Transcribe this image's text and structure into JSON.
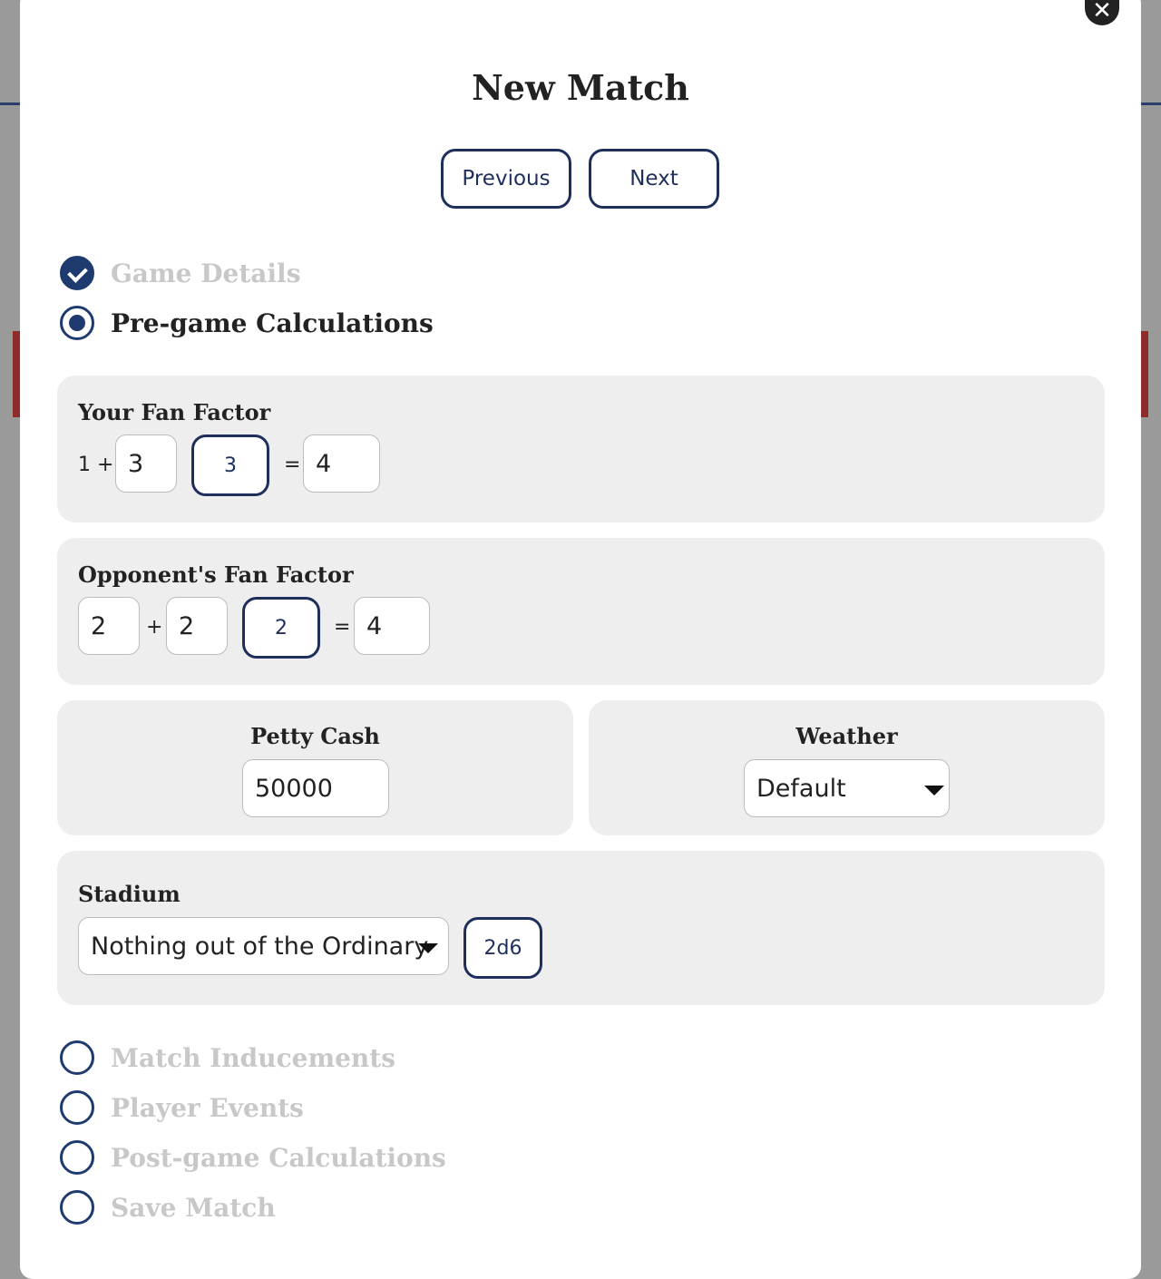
{
  "modal": {
    "title": "New Match",
    "close_icon": "close-icon",
    "previous_label": "Previous",
    "next_label": "Next"
  },
  "steps": [
    {
      "label": "Game Details",
      "state": "done"
    },
    {
      "label": "Pre-game Calculations",
      "state": "current"
    },
    {
      "label": "Match Inducements",
      "state": "pending"
    },
    {
      "label": "Player Events",
      "state": "pending"
    },
    {
      "label": "Post-game Calculations",
      "state": "pending"
    },
    {
      "label": "Save Match",
      "state": "pending"
    }
  ],
  "your_fan_factor": {
    "title": "Your Fan Factor",
    "base": "1 +",
    "input": "3",
    "roll": "3",
    "equals": "=",
    "result": "4"
  },
  "opponent_fan_factor": {
    "title": "Opponent's Fan Factor",
    "input_a": "2",
    "plus": "+",
    "input_b": "2",
    "roll": "2",
    "equals": "=",
    "result": "4"
  },
  "petty_cash": {
    "title": "Petty Cash",
    "value": "50000"
  },
  "weather": {
    "title": "Weather",
    "selected": "Default"
  },
  "stadium": {
    "title": "Stadium",
    "selected": "Nothing out of the Ordinary",
    "roll": "2d6"
  },
  "colors": {
    "accent": "#1e2f5c",
    "panel": "#eeeeee",
    "inactive_text": "#c8c8c8"
  }
}
